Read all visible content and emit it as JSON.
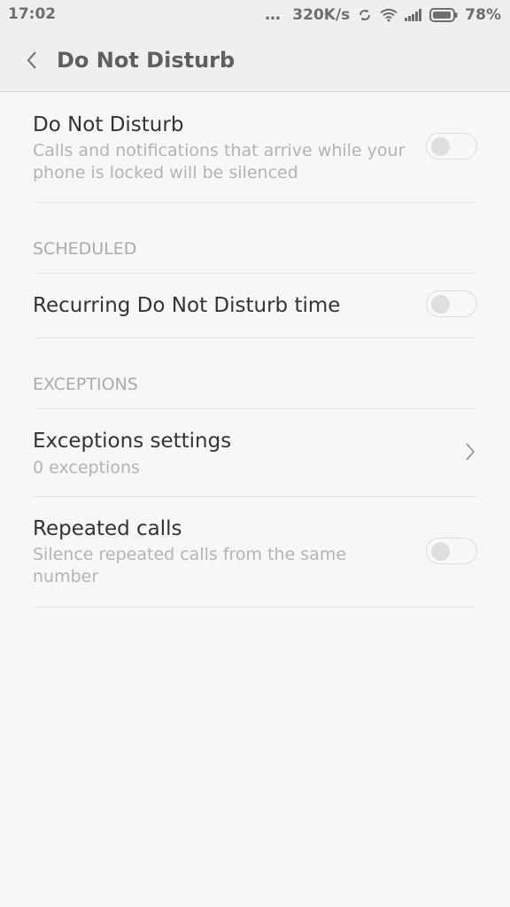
{
  "status_bar": {
    "time": "17:02",
    "dots": "...",
    "network_speed": "320K/s",
    "battery": "78%"
  },
  "header": {
    "title": "Do Not Disturb"
  },
  "dnd": {
    "title": "Do Not Disturb",
    "subtitle": "Calls and notifications that arrive while your phone is locked will be silenced",
    "enabled": false
  },
  "scheduled": {
    "section_label": "SCHEDULED",
    "recurring_title": "Recurring Do Not Disturb time",
    "recurring_enabled": false
  },
  "exceptions": {
    "section_label": "EXCEPTIONS",
    "settings_title": "Exceptions settings",
    "settings_subtitle": "0 exceptions",
    "repeated_title": "Repeated calls",
    "repeated_subtitle": "Silence repeated calls from the same number",
    "repeated_enabled": false
  },
  "colors": {
    "background": "#f7f7f7",
    "header_bg": "#efefef",
    "title_text": "#333333",
    "secondary_text": "#b3b3b3"
  },
  "icons": {
    "back": "chevron-left-icon",
    "chevron": "chevron-right-icon",
    "sync": "sync-icon",
    "wifi": "wifi-icon",
    "signal": "signal-icon",
    "battery": "battery-icon"
  }
}
